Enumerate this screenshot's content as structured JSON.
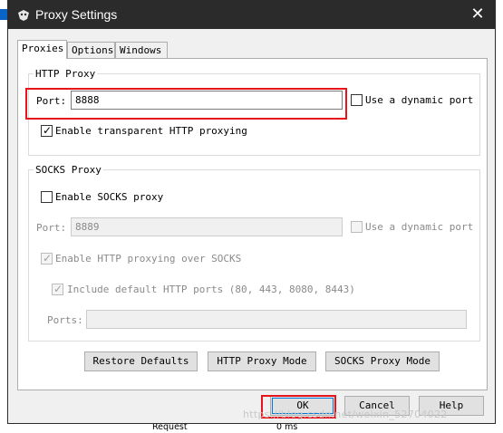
{
  "window": {
    "title": "Proxy Settings"
  },
  "tabs": [
    {
      "label": "Proxies"
    },
    {
      "label": "Options"
    },
    {
      "label": "Windows"
    }
  ],
  "http_proxy": {
    "legend": "HTTP Proxy",
    "port_label": "Port:",
    "port_value": "8888",
    "dynamic_port_label": "Use a dynamic port",
    "dynamic_port_checked": false,
    "transparent_label": "Enable transparent HTTP proxying",
    "transparent_checked": true
  },
  "socks_proxy": {
    "legend": "SOCKS Proxy",
    "enable_label": "Enable SOCKS proxy",
    "enable_checked": false,
    "port_label": "Port:",
    "port_value": "8889",
    "dynamic_port_label": "Use a dynamic port",
    "http_over_socks_label": "Enable HTTP proxying over SOCKS",
    "http_over_socks_checked": true,
    "include_ports_label": "Include default HTTP ports (80, 443, 8080, 8443)",
    "include_ports_checked": true,
    "ports_label": "Ports:",
    "ports_value": ""
  },
  "mode_buttons": {
    "restore": "Restore Defaults",
    "http_mode": "HTTP Proxy Mode",
    "socks_mode": "SOCKS Proxy Mode"
  },
  "dialog_buttons": {
    "ok": "OK",
    "cancel": "Cancel",
    "help": "Help"
  },
  "background": {
    "bottom_row_label": "Request",
    "bottom_row_value": "0 ms"
  },
  "watermark": "https://blog.csdn.net/weixin_52704022",
  "colors": {
    "highlight_box": "#e8141c",
    "titlebar": "#2b2b2b"
  }
}
